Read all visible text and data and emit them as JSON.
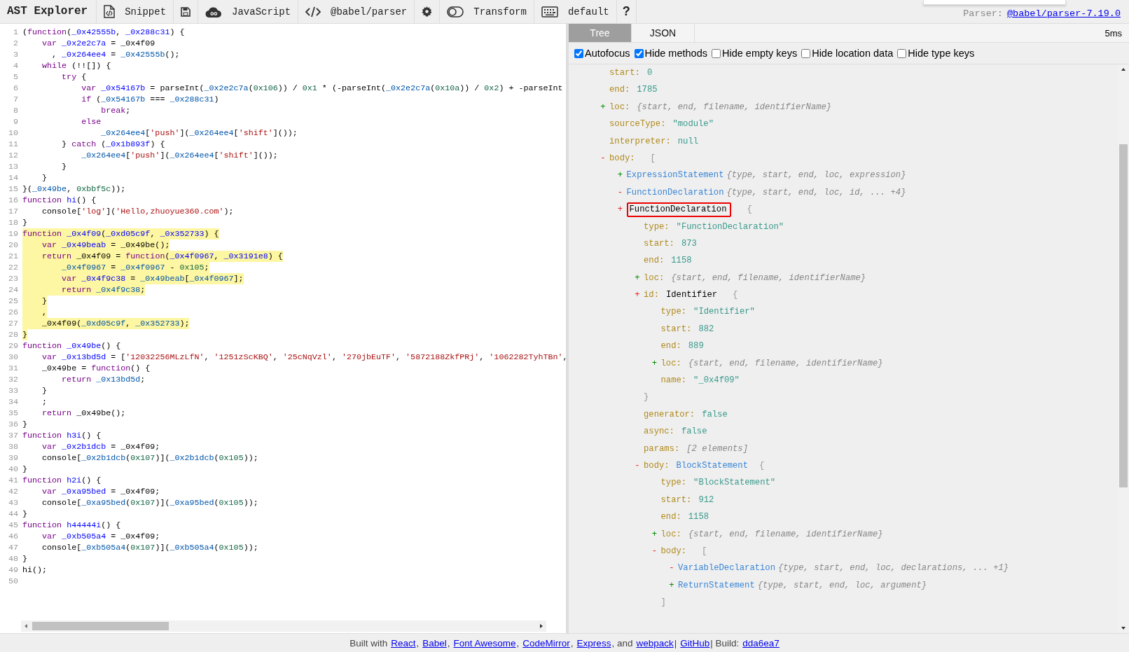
{
  "toolbar": {
    "title": "AST Explorer",
    "items": [
      {
        "kind": "snippet",
        "label": "Snippet"
      },
      {
        "kind": "save"
      },
      {
        "kind": "language",
        "label": "JavaScript"
      },
      {
        "kind": "parser",
        "label": "@babel/parser"
      },
      {
        "kind": "settings"
      },
      {
        "kind": "transform",
        "label": "Transform",
        "on": false
      },
      {
        "kind": "keymap",
        "label": "default"
      },
      {
        "kind": "help",
        "label": "?"
      }
    ],
    "parser_label": "Parser:",
    "parser_link": "@babel/parser-7.19.0"
  },
  "editor": {
    "lines": [
      {
        "number": "1",
        "tokens": [
          {
            "kind": "plain",
            "text": "("
          },
          {
            "kind": "keyword",
            "text": "function"
          },
          {
            "kind": "plain",
            "text": "("
          },
          {
            "kind": "def",
            "text": "_0x42555b"
          },
          {
            "kind": "plain",
            "text": ", "
          },
          {
            "kind": "def",
            "text": "_0x288c31"
          },
          {
            "kind": "plain",
            "text": ") {"
          }
        ]
      },
      {
        "number": "2",
        "tokens": [
          {
            "kind": "keyword",
            "text": "    var "
          },
          {
            "kind": "def",
            "text": "_0x2e2c7a"
          },
          {
            "kind": "plain",
            "text": " = _0x4f09"
          }
        ]
      },
      {
        "number": "3",
        "tokens": [
          {
            "kind": "plain",
            "text": "      , "
          },
          {
            "kind": "def",
            "text": "_0x264ee4"
          },
          {
            "kind": "plain",
            "text": " = "
          },
          {
            "kind": "var",
            "text": "_0x42555b"
          },
          {
            "kind": "plain",
            "text": "();"
          }
        ]
      },
      {
        "number": "4",
        "tokens": [
          {
            "kind": "keyword",
            "text": "    while"
          },
          {
            "kind": "plain",
            "text": " (!![]) {"
          }
        ]
      },
      {
        "number": "5",
        "tokens": [
          {
            "kind": "keyword",
            "text": "        try"
          },
          {
            "kind": "plain",
            "text": " {"
          }
        ]
      },
      {
        "number": "6",
        "tokens": [
          {
            "kind": "keyword",
            "text": "            var "
          },
          {
            "kind": "def",
            "text": "_0x54167b"
          },
          {
            "kind": "plain",
            "text": " = parseInt("
          },
          {
            "kind": "var",
            "text": "_0x2e2c7a"
          },
          {
            "kind": "plain",
            "text": "("
          },
          {
            "kind": "number",
            "text": "0x106"
          },
          {
            "kind": "plain",
            "text": ")) / "
          },
          {
            "kind": "number",
            "text": "0x1"
          },
          {
            "kind": "plain",
            "text": " * (-parseInt("
          },
          {
            "kind": "var",
            "text": "_0x2e2c7a"
          },
          {
            "kind": "plain",
            "text": "("
          },
          {
            "kind": "number",
            "text": "0x10a"
          },
          {
            "kind": "plain",
            "text": ")) / "
          },
          {
            "kind": "number",
            "text": "0x2"
          },
          {
            "kind": "plain",
            "text": ") + -parseInt"
          }
        ]
      },
      {
        "number": "7",
        "tokens": [
          {
            "kind": "keyword",
            "text": "            if"
          },
          {
            "kind": "plain",
            "text": " ("
          },
          {
            "kind": "var",
            "text": "_0x54167b"
          },
          {
            "kind": "plain",
            "text": " === "
          },
          {
            "kind": "var",
            "text": "_0x288c31"
          },
          {
            "kind": "plain",
            "text": ")"
          }
        ]
      },
      {
        "number": "8",
        "tokens": [
          {
            "kind": "keyword",
            "text": "                break"
          },
          {
            "kind": "plain",
            "text": ";"
          }
        ]
      },
      {
        "number": "9",
        "tokens": [
          {
            "kind": "keyword",
            "text": "            else"
          }
        ]
      },
      {
        "number": "10",
        "tokens": [
          {
            "kind": "var",
            "text": "                _0x264ee4"
          },
          {
            "kind": "plain",
            "text": "["
          },
          {
            "kind": "string",
            "text": "'push'"
          },
          {
            "kind": "plain",
            "text": "]("
          },
          {
            "kind": "var",
            "text": "_0x264ee4"
          },
          {
            "kind": "plain",
            "text": "["
          },
          {
            "kind": "string",
            "text": "'shift'"
          },
          {
            "kind": "plain",
            "text": "]());"
          }
        ]
      },
      {
        "number": "11",
        "tokens": [
          {
            "kind": "plain",
            "text": "        } "
          },
          {
            "kind": "keyword",
            "text": "catch"
          },
          {
            "kind": "plain",
            "text": " ("
          },
          {
            "kind": "def",
            "text": "_0x1b893f"
          },
          {
            "kind": "plain",
            "text": ") {"
          }
        ]
      },
      {
        "number": "12",
        "tokens": [
          {
            "kind": "var",
            "text": "            _0x264ee4"
          },
          {
            "kind": "plain",
            "text": "["
          },
          {
            "kind": "string",
            "text": "'push'"
          },
          {
            "kind": "plain",
            "text": "]("
          },
          {
            "kind": "var",
            "text": "_0x264ee4"
          },
          {
            "kind": "plain",
            "text": "["
          },
          {
            "kind": "string",
            "text": "'shift'"
          },
          {
            "kind": "plain",
            "text": "]());"
          }
        ]
      },
      {
        "number": "13",
        "tokens": [
          {
            "kind": "plain",
            "text": "        }"
          }
        ]
      },
      {
        "number": "14",
        "tokens": [
          {
            "kind": "plain",
            "text": "    }"
          }
        ]
      },
      {
        "number": "15",
        "tokens": [
          {
            "kind": "plain",
            "text": "}("
          },
          {
            "kind": "var",
            "text": "_0x49be"
          },
          {
            "kind": "plain",
            "text": ", "
          },
          {
            "kind": "number",
            "text": "0xbbf5c"
          },
          {
            "kind": "plain",
            "text": "));"
          }
        ]
      },
      {
        "number": "16",
        "tokens": [
          {
            "kind": "keyword",
            "text": "function "
          },
          {
            "kind": "def",
            "text": "hi"
          },
          {
            "kind": "plain",
            "text": "() {"
          }
        ]
      },
      {
        "number": "17",
        "tokens": [
          {
            "kind": "plain",
            "text": "    console["
          },
          {
            "kind": "string",
            "text": "'log'"
          },
          {
            "kind": "plain",
            "text": "]("
          },
          {
            "kind": "string",
            "text": "'Hello,zhuoyue360.com'"
          },
          {
            "kind": "plain",
            "text": ");"
          }
        ]
      },
      {
        "number": "18",
        "tokens": [
          {
            "kind": "plain",
            "text": "}"
          }
        ]
      },
      {
        "number": "19",
        "highlighted": true,
        "tokens": [
          {
            "kind": "keyword",
            "text": "function "
          },
          {
            "kind": "def",
            "text": "_0x4f09"
          },
          {
            "kind": "plain",
            "text": "("
          },
          {
            "kind": "def",
            "text": "_0xd05c9f"
          },
          {
            "kind": "plain",
            "text": ", "
          },
          {
            "kind": "def",
            "text": "_0x352733"
          },
          {
            "kind": "plain",
            "text": ") {"
          }
        ]
      },
      {
        "number": "20",
        "highlighted": true,
        "tokens": [
          {
            "kind": "keyword",
            "text": "    var "
          },
          {
            "kind": "def",
            "text": "_0x49beab"
          },
          {
            "kind": "plain",
            "text": " = _0x49be();"
          }
        ]
      },
      {
        "number": "21",
        "highlighted": true,
        "tokens": [
          {
            "kind": "keyword",
            "text": "    return"
          },
          {
            "kind": "plain",
            "text": " _0x4f09 = "
          },
          {
            "kind": "keyword",
            "text": "function"
          },
          {
            "kind": "plain",
            "text": "("
          },
          {
            "kind": "def",
            "text": "_0x4f0967"
          },
          {
            "kind": "plain",
            "text": ", "
          },
          {
            "kind": "def",
            "text": "_0x3191e8"
          },
          {
            "kind": "plain",
            "text": ") {"
          }
        ]
      },
      {
        "number": "22",
        "highlighted": true,
        "tokens": [
          {
            "kind": "var",
            "text": "        _0x4f0967"
          },
          {
            "kind": "plain",
            "text": " = "
          },
          {
            "kind": "var",
            "text": "_0x4f0967"
          },
          {
            "kind": "plain",
            "text": " - "
          },
          {
            "kind": "number",
            "text": "0x105"
          },
          {
            "kind": "plain",
            "text": ";"
          }
        ]
      },
      {
        "number": "23",
        "highlighted": true,
        "tokens": [
          {
            "kind": "keyword",
            "text": "        var "
          },
          {
            "kind": "def",
            "text": "_0x4f9c38"
          },
          {
            "kind": "plain",
            "text": " = "
          },
          {
            "kind": "var",
            "text": "_0x49beab"
          },
          {
            "kind": "plain",
            "text": "["
          },
          {
            "kind": "var",
            "text": "_0x4f0967"
          },
          {
            "kind": "plain",
            "text": "];"
          }
        ]
      },
      {
        "number": "24",
        "highlighted": true,
        "tokens": [
          {
            "kind": "keyword",
            "text": "        return "
          },
          {
            "kind": "var",
            "text": "_0x4f9c38"
          },
          {
            "kind": "plain",
            "text": ";"
          }
        ]
      },
      {
        "number": "25",
        "highlighted": true,
        "tokens": [
          {
            "kind": "plain",
            "text": "    }"
          }
        ]
      },
      {
        "number": "26",
        "highlighted": true,
        "tokens": [
          {
            "kind": "plain",
            "text": "    ,"
          }
        ]
      },
      {
        "number": "27",
        "highlighted": true,
        "tokens": [
          {
            "kind": "plain",
            "text": "    _0x4f09("
          },
          {
            "kind": "var",
            "text": "_0xd05c9f"
          },
          {
            "kind": "plain",
            "text": ", "
          },
          {
            "kind": "var",
            "text": "_0x352733"
          },
          {
            "kind": "plain",
            "text": ");"
          }
        ]
      },
      {
        "number": "28",
        "highlighted": true,
        "tokens": [
          {
            "kind": "plain",
            "text": "}"
          }
        ]
      },
      {
        "number": "29",
        "tokens": [
          {
            "kind": "keyword",
            "text": "function "
          },
          {
            "kind": "def",
            "text": "_0x49be"
          },
          {
            "kind": "plain",
            "text": "() {"
          }
        ]
      },
      {
        "number": "30",
        "tokens": [
          {
            "kind": "keyword",
            "text": "    var "
          },
          {
            "kind": "def",
            "text": "_0x13bd5d"
          },
          {
            "kind": "plain",
            "text": " = ["
          },
          {
            "kind": "string",
            "text": "'12032256MLzLfN'"
          },
          {
            "kind": "plain",
            "text": ", "
          },
          {
            "kind": "string",
            "text": "'1251zScKBQ'"
          },
          {
            "kind": "plain",
            "text": ", "
          },
          {
            "kind": "string",
            "text": "'25cNqVzl'"
          },
          {
            "kind": "plain",
            "text": ", "
          },
          {
            "kind": "string",
            "text": "'270jbEuTF'"
          },
          {
            "kind": "plain",
            "text": ", "
          },
          {
            "kind": "string",
            "text": "'5872188ZkfPRj'"
          },
          {
            "kind": "plain",
            "text": ", "
          },
          {
            "kind": "string",
            "text": "'1062282TyhTBn'"
          },
          {
            "kind": "plain",
            "text": ","
          }
        ]
      },
      {
        "number": "31",
        "tokens": [
          {
            "kind": "plain",
            "text": "    _0x49be = "
          },
          {
            "kind": "keyword",
            "text": "function"
          },
          {
            "kind": "plain",
            "text": "() {"
          }
        ]
      },
      {
        "number": "32",
        "tokens": [
          {
            "kind": "keyword",
            "text": "        return "
          },
          {
            "kind": "var",
            "text": "_0x13bd5d"
          },
          {
            "kind": "plain",
            "text": ";"
          }
        ]
      },
      {
        "number": "33",
        "tokens": [
          {
            "kind": "plain",
            "text": "    }"
          }
        ]
      },
      {
        "number": "34",
        "tokens": [
          {
            "kind": "plain",
            "text": "    ;"
          }
        ]
      },
      {
        "number": "35",
        "tokens": [
          {
            "kind": "keyword",
            "text": "    return"
          },
          {
            "kind": "plain",
            "text": " _0x49be();"
          }
        ]
      },
      {
        "number": "36",
        "tokens": [
          {
            "kind": "plain",
            "text": "}"
          }
        ]
      },
      {
        "number": "37",
        "tokens": [
          {
            "kind": "keyword",
            "text": "function "
          },
          {
            "kind": "def",
            "text": "h3i"
          },
          {
            "kind": "plain",
            "text": "() {"
          }
        ]
      },
      {
        "number": "38",
        "tokens": [
          {
            "kind": "keyword",
            "text": "    var "
          },
          {
            "kind": "def",
            "text": "_0x2b1dcb"
          },
          {
            "kind": "plain",
            "text": " = _0x4f09;"
          }
        ]
      },
      {
        "number": "39",
        "tokens": [
          {
            "kind": "plain",
            "text": "    console["
          },
          {
            "kind": "var",
            "text": "_0x2b1dcb"
          },
          {
            "kind": "plain",
            "text": "("
          },
          {
            "kind": "number",
            "text": "0x107"
          },
          {
            "kind": "plain",
            "text": ")]("
          },
          {
            "kind": "var",
            "text": "_0x2b1dcb"
          },
          {
            "kind": "plain",
            "text": "("
          },
          {
            "kind": "number",
            "text": "0x105"
          },
          {
            "kind": "plain",
            "text": "));"
          }
        ]
      },
      {
        "number": "40",
        "tokens": [
          {
            "kind": "plain",
            "text": "}"
          }
        ]
      },
      {
        "number": "41",
        "tokens": [
          {
            "kind": "keyword",
            "text": "function "
          },
          {
            "kind": "def",
            "text": "h2i"
          },
          {
            "kind": "plain",
            "text": "() {"
          }
        ]
      },
      {
        "number": "42",
        "tokens": [
          {
            "kind": "keyword",
            "text": "    var "
          },
          {
            "kind": "def",
            "text": "_0xa95bed"
          },
          {
            "kind": "plain",
            "text": " = _0x4f09;"
          }
        ]
      },
      {
        "number": "43",
        "tokens": [
          {
            "kind": "plain",
            "text": "    console["
          },
          {
            "kind": "var",
            "text": "_0xa95bed"
          },
          {
            "kind": "plain",
            "text": "("
          },
          {
            "kind": "number",
            "text": "0x107"
          },
          {
            "kind": "plain",
            "text": ")]("
          },
          {
            "kind": "var",
            "text": "_0xa95bed"
          },
          {
            "kind": "plain",
            "text": "("
          },
          {
            "kind": "number",
            "text": "0x105"
          },
          {
            "kind": "plain",
            "text": "));"
          }
        ]
      },
      {
        "number": "44",
        "tokens": [
          {
            "kind": "plain",
            "text": "}"
          }
        ]
      },
      {
        "number": "45",
        "tokens": [
          {
            "kind": "keyword",
            "text": "function "
          },
          {
            "kind": "def",
            "text": "h44444i"
          },
          {
            "kind": "plain",
            "text": "() {"
          }
        ]
      },
      {
        "number": "46",
        "tokens": [
          {
            "kind": "keyword",
            "text": "    var "
          },
          {
            "kind": "def",
            "text": "_0xb505a4"
          },
          {
            "kind": "plain",
            "text": " = _0x4f09;"
          }
        ]
      },
      {
        "number": "47",
        "tokens": [
          {
            "kind": "plain",
            "text": "    console["
          },
          {
            "kind": "var",
            "text": "_0xb505a4"
          },
          {
            "kind": "plain",
            "text": "("
          },
          {
            "kind": "number",
            "text": "0x107"
          },
          {
            "kind": "plain",
            "text": ")]("
          },
          {
            "kind": "var",
            "text": "_0xb505a4"
          },
          {
            "kind": "plain",
            "text": "("
          },
          {
            "kind": "number",
            "text": "0x105"
          },
          {
            "kind": "plain",
            "text": "));"
          }
        ]
      },
      {
        "number": "48",
        "tokens": [
          {
            "kind": "plain",
            "text": "}"
          }
        ]
      },
      {
        "number": "49",
        "tokens": [
          {
            "kind": "plain",
            "text": "hi();"
          }
        ]
      },
      {
        "number": "50"
      }
    ]
  },
  "output": {
    "tabs": [
      {
        "label": "Tree",
        "selected": true
      },
      {
        "label": "JSON",
        "selected": false
      }
    ],
    "time": "5ms",
    "options": [
      {
        "label": "Autofocus",
        "checked": true
      },
      {
        "label": "Hide methods",
        "checked": true
      },
      {
        "label": "Hide empty keys",
        "checked": false
      },
      {
        "label": "Hide location data",
        "checked": false
      },
      {
        "label": "Hide type keys",
        "checked": false
      }
    ],
    "tree": [
      {
        "key": "start:",
        "value": "0",
        "kind": "literal"
      },
      {
        "key": "end:",
        "value": "1785",
        "kind": "literal"
      },
      {
        "toggle": "+",
        "expanded": false,
        "key": "loc:",
        "summary": "{start, end, filename, identifierName}"
      },
      {
        "key": "sourceType:",
        "value": "\"module\"",
        "kind": "literal"
      },
      {
        "key": "interpreter:",
        "value": "null",
        "kind": "literal"
      },
      {
        "toggle": "-",
        "expanded": true,
        "key": "body:",
        "bracket": "[",
        "children": [
          {
            "toggle": "+",
            "expanded": false,
            "value": "ExpressionStatement",
            "kind": "node",
            "summary": "{type, start, end, loc, expression}"
          },
          {
            "toggle": "-",
            "expanded": true,
            "value": "FunctionDeclaration",
            "kind": "node",
            "summary": "{type, start, end, loc, id, ... +4}"
          },
          {
            "toggle": "+",
            "expanded": true,
            "selected": true,
            "value": "FunctionDeclaration",
            "kind": "plain",
            "bracket": "{",
            "children": [
              {
                "key": "type:",
                "value": "\"FunctionDeclaration\"",
                "kind": "literal"
              },
              {
                "key": "start:",
                "value": "873",
                "kind": "literal"
              },
              {
                "key": "end:",
                "value": "1158",
                "kind": "literal"
              },
              {
                "toggle": "+",
                "expanded": false,
                "key": "loc:",
                "summary": "{start, end, filename, identifierName}"
              },
              {
                "toggle": "+",
                "expanded": true,
                "key": "id:",
                "value": "Identifier",
                "kind": "plain",
                "bracket": "{",
                "close": "}",
                "children": [
                  {
                    "key": "type:",
                    "value": "\"Identifier\"",
                    "kind": "literal"
                  },
                  {
                    "key": "start:",
                    "value": "882",
                    "kind": "literal"
                  },
                  {
                    "key": "end:",
                    "value": "889",
                    "kind": "literal"
                  },
                  {
                    "toggle": "+",
                    "expanded": false,
                    "key": "loc:",
                    "summary": "{start, end, filename, identifierName}"
                  },
                  {
                    "key": "name:",
                    "value": "\"_0x4f09\"",
                    "kind": "literal"
                  }
                ]
              },
              {
                "key": "generator:",
                "value": "false",
                "kind": "literal"
              },
              {
                "key": "async:",
                "value": "false",
                "kind": "literal"
              },
              {
                "key": "params:",
                "summary": "[2 elements]"
              },
              {
                "toggle": "-",
                "expanded": true,
                "key": "body:",
                "value": "BlockStatement",
                "kind": "node",
                "bracket": "{",
                "children": [
                  {
                    "key": "type:",
                    "value": "\"BlockStatement\"",
                    "kind": "literal"
                  },
                  {
                    "key": "start:",
                    "value": "912",
                    "kind": "literal"
                  },
                  {
                    "key": "end:",
                    "value": "1158",
                    "kind": "literal"
                  },
                  {
                    "toggle": "+",
                    "expanded": false,
                    "key": "loc:",
                    "summary": "{start, end, filename, identifierName}"
                  },
                  {
                    "toggle": "-",
                    "expanded": true,
                    "key": "body:",
                    "bracket": "[",
                    "close": "]",
                    "children": [
                      {
                        "toggle": "-",
                        "expanded": true,
                        "value": "VariableDeclaration",
                        "kind": "node",
                        "summary": "{type, start, end, loc, declarations, ... +1}"
                      },
                      {
                        "toggle": "+",
                        "expanded": false,
                        "value": "ReturnStatement",
                        "kind": "node",
                        "summary": "{type, start, end, loc, argument}"
                      }
                    ]
                  }
                ]
              }
            ]
          }
        ]
      }
    ]
  },
  "footer": [
    {
      "kind": "text",
      "text": "Built with"
    },
    {
      "kind": "link",
      "text": "React"
    },
    {
      "kind": "text",
      "text": ","
    },
    {
      "kind": "link",
      "text": "Babel"
    },
    {
      "kind": "text",
      "text": ","
    },
    {
      "kind": "link",
      "text": "Font Awesome"
    },
    {
      "kind": "text",
      "text": ","
    },
    {
      "kind": "link",
      "text": "CodeMirror"
    },
    {
      "kind": "text",
      "text": ","
    },
    {
      "kind": "link",
      "text": "Express"
    },
    {
      "kind": "text",
      "text": ", and"
    },
    {
      "kind": "link",
      "text": "webpack"
    },
    {
      "kind": "text",
      "text": "|"
    },
    {
      "kind": "link",
      "text": "GitHub"
    },
    {
      "kind": "text",
      "text": "| Build:"
    },
    {
      "kind": "link",
      "text": "dda6ea7"
    }
  ]
}
